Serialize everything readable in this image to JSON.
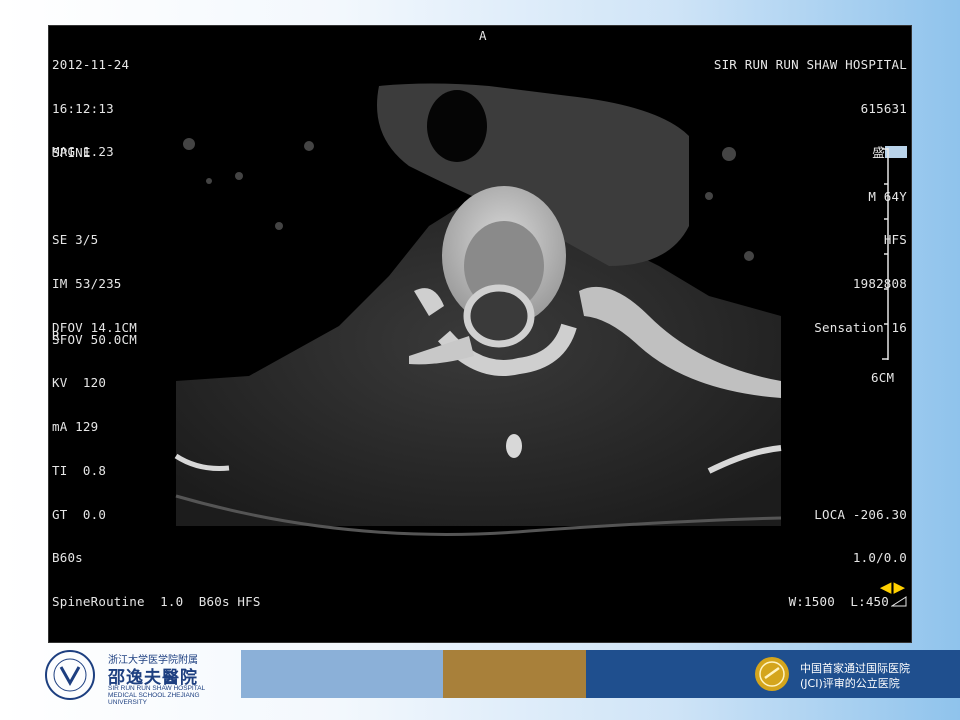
{
  "scan": {
    "top_left": [
      "2012-11-24",
      "16:12:13",
      "SPINE",
      "",
      "SE 3/5",
      "IM 53/235",
      "DFOV 14.1CM"
    ],
    "mag": "MAG 1.23",
    "orientation_top": "A",
    "orientation_left": "R",
    "top_right": {
      "hospital": "SIR RUN RUN SHAW HOSPITAL",
      "patient_id": "615631",
      "patient_name": "盛",
      "sex_age": "M 64Y",
      "position": "HFS",
      "accession": "1982808",
      "scanner": "Sensation 16"
    },
    "scale_label": "6CM",
    "bottom_left": [
      "SFOV 50.0CM",
      "KV  120",
      "mA 129",
      "TI  0.8",
      "GT  0.0",
      "B60s",
      "SpineRoutine  1.0  B60s HFS"
    ],
    "bottom_right": [
      "LOCA -206.30",
      "1.0/0.0",
      "W:1500  L:450"
    ],
    "arrows_glyph": "◀▶",
    "accent": "#ffd000"
  },
  "footer": {
    "logo_line1": "浙江大学医学院附属",
    "logo_line2": "邵逸夫醫院",
    "logo_line3": "SIR RUN RUN SHAW HOSPITAL",
    "logo_line4": "MEDICAL SCHOOL ZHEJIANG UNIVERSITY",
    "jci_line1": "中国首家通过国际医院",
    "jci_line2": "(JCI)评审的公立医院",
    "colors": {
      "light_blue": "#8bb0d8",
      "gold": "#a8803a",
      "navy": "#1f4f8e"
    }
  }
}
